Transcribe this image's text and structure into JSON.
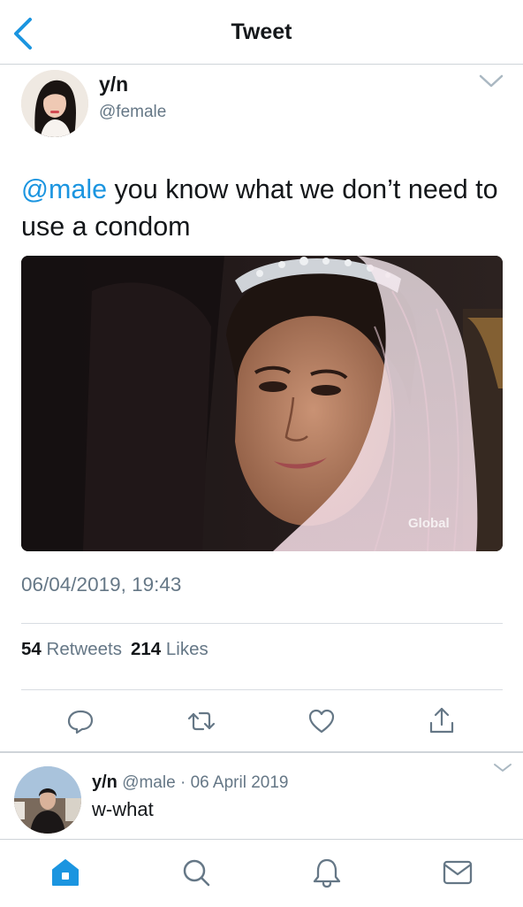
{
  "header": {
    "title": "Tweet",
    "back_icon": "chevron-left-icon"
  },
  "tweet": {
    "author_name": "y/n",
    "author_handle": "@female",
    "mention": "@male",
    "text_rest": " you know what we don’t need to use a condom",
    "media_watermark": "Global",
    "timestamp": "06/04/2019, 19:43",
    "retweets_count": "54",
    "retweets_label": "Retweets",
    "likes_count": "214",
    "likes_label": "Likes"
  },
  "actions": [
    {
      "name": "reply-icon"
    },
    {
      "name": "retweet-icon"
    },
    {
      "name": "like-icon"
    },
    {
      "name": "share-icon"
    }
  ],
  "reply": {
    "name": "y/n",
    "handle": "@male",
    "separator": "·",
    "date": "06 April 2019",
    "text": "w-what"
  },
  "tabbar": {
    "items": [
      "home-icon",
      "search-icon",
      "notifications-icon",
      "messages-icon"
    ],
    "active": "home-icon"
  },
  "colors": {
    "accent": "#1b95e0",
    "text": "#14171a",
    "secondary": "#657786",
    "divider": "#cfd4d9"
  }
}
